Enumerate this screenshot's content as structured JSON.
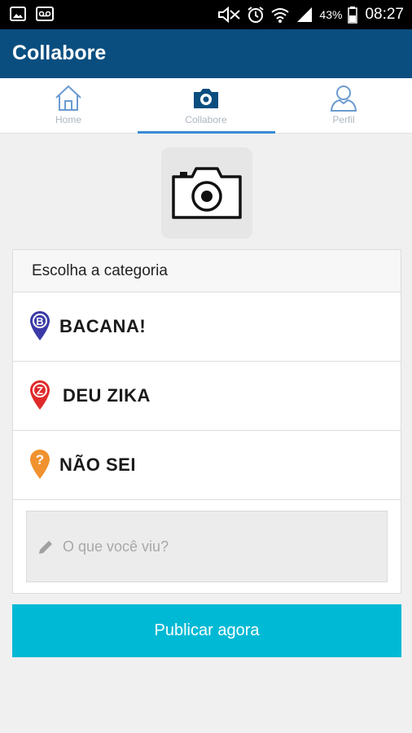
{
  "status_bar": {
    "battery": "43%",
    "time": "08:27"
  },
  "app": {
    "title": "Collabore"
  },
  "tabs": [
    {
      "label": "Home",
      "icon": "home-icon"
    },
    {
      "label": "Collabore",
      "icon": "camera-icon",
      "selected": true
    },
    {
      "label": "Perfil",
      "icon": "person-icon"
    }
  ],
  "photo": {
    "icon": "camera-icon"
  },
  "form": {
    "header": "Escolha a categoria",
    "categories": [
      {
        "label": "BACANA!",
        "icon": "bacana-pin-icon",
        "color": "#3a3aa8",
        "glyph": "B"
      },
      {
        "label": "DEU ZIKA",
        "icon": "zika-pin-icon",
        "color": "#e02a2a",
        "glyph": "Z"
      },
      {
        "label": "NÃO SEI",
        "icon": "question-pin-icon",
        "color": "#f0922f",
        "glyph": "?"
      }
    ],
    "comment": {
      "placeholder": "O que você viu?",
      "value": ""
    }
  },
  "publish": {
    "label": "Publicar agora"
  },
  "colors": {
    "appbar": "#0a4e80",
    "accent": "#3a8ad6",
    "publish": "#00b9d5"
  }
}
